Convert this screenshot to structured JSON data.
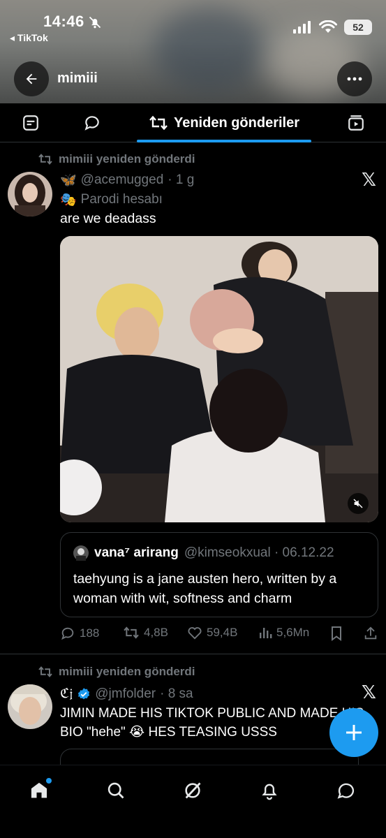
{
  "status_bar": {
    "time": "14:46",
    "back_app": "◂ TikTok",
    "battery": "52"
  },
  "header": {
    "title": "mimiii"
  },
  "tabs": {
    "active_label": "Yeniden gönderiler",
    "items": [
      "posts-tab",
      "replies-tab",
      "reposts-tab",
      "media-tab"
    ]
  },
  "posts": [
    {
      "repost_label": "mimiii yeniden gönderdi",
      "emoji": "🦋",
      "handle": "@acemugged",
      "time": "· 1 g",
      "parody_emoji": "🎭",
      "parody_label": "Parodi hesabı",
      "text": "are we deadass",
      "quote": {
        "name": "vana⁷ arirang",
        "handle": "@kimseokxual · 06.12.22",
        "text": "taehyung is a jane austen hero, written by a woman with wit, softness and charm"
      },
      "stats": {
        "replies": "188",
        "reposts": "4,8B",
        "likes": "59,4B",
        "views": "5,6Mn"
      }
    },
    {
      "repost_label": "mimiii yeniden gönderdi",
      "name": "ℭ𝔧",
      "handle": "@jmfolder",
      "time": "· 8 sa",
      "text": "JIMIN MADE HIS TIKTOK PUBLIC AND MADE HIS BIO \"hehe\" 😭 HES TEASING USSS"
    }
  ],
  "colors": {
    "accent": "#1d9bf0",
    "muted": "#71767b",
    "border": "#2f3336"
  },
  "icons": [
    "back-arrow-icon",
    "more-icon",
    "repost-icon",
    "x-logo-icon",
    "verified-icon",
    "mute-icon",
    "reply-icon",
    "like-icon",
    "views-icon",
    "bookmark-icon",
    "share-icon",
    "plus-icon",
    "home-icon",
    "search-icon",
    "grok-icon",
    "bell-icon",
    "messages-icon"
  ]
}
